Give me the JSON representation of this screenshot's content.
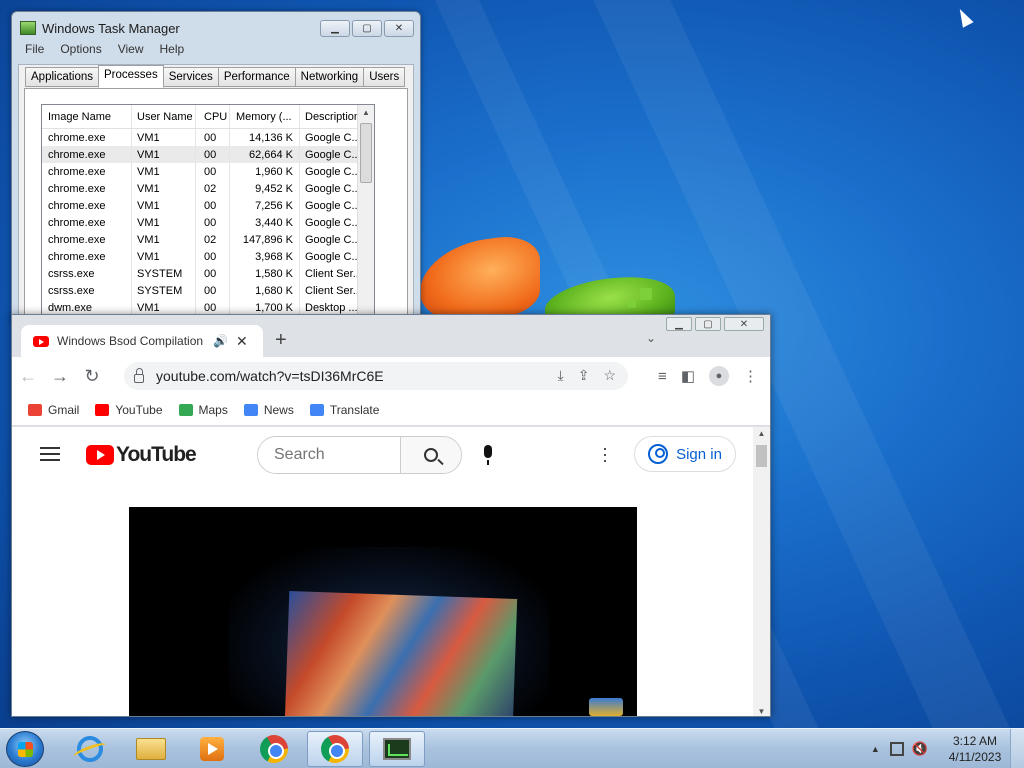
{
  "task_manager": {
    "title": "Windows Task Manager",
    "menu": [
      "File",
      "Options",
      "View",
      "Help"
    ],
    "tabs": [
      "Applications",
      "Processes",
      "Services",
      "Performance",
      "Networking",
      "Users"
    ],
    "active_tab": "Processes",
    "columns": [
      "Image Name",
      "User Name",
      "CPU",
      "Memory (...",
      "Description"
    ],
    "rows": [
      {
        "name": "chrome.exe",
        "user": "VM1",
        "cpu": "00",
        "mem": "14,136 K",
        "desc": "Google C..."
      },
      {
        "name": "chrome.exe",
        "user": "VM1",
        "cpu": "00",
        "mem": "62,664 K",
        "desc": "Google C..."
      },
      {
        "name": "chrome.exe",
        "user": "VM1",
        "cpu": "00",
        "mem": "1,960 K",
        "desc": "Google C..."
      },
      {
        "name": "chrome.exe",
        "user": "VM1",
        "cpu": "02",
        "mem": "9,452 K",
        "desc": "Google C..."
      },
      {
        "name": "chrome.exe",
        "user": "VM1",
        "cpu": "00",
        "mem": "7,256 K",
        "desc": "Google C..."
      },
      {
        "name": "chrome.exe",
        "user": "VM1",
        "cpu": "00",
        "mem": "3,440 K",
        "desc": "Google C..."
      },
      {
        "name": "chrome.exe",
        "user": "VM1",
        "cpu": "02",
        "mem": "147,896 K",
        "desc": "Google C..."
      },
      {
        "name": "chrome.exe",
        "user": "VM1",
        "cpu": "00",
        "mem": "3,968 K",
        "desc": "Google C..."
      },
      {
        "name": "csrss.exe",
        "user": "SYSTEM",
        "cpu": "00",
        "mem": "1,580 K",
        "desc": "Client Ser..."
      },
      {
        "name": "csrss.exe",
        "user": "SYSTEM",
        "cpu": "00",
        "mem": "1,680 K",
        "desc": "Client Ser..."
      },
      {
        "name": "dwm.exe",
        "user": "VM1",
        "cpu": "00",
        "mem": "1,700 K",
        "desc": "Desktop ..."
      }
    ]
  },
  "chrome": {
    "tab_title": "Windows Bsod Compilation",
    "url": "youtube.com/watch?v=tsDI36MrC6E",
    "bookmarks": [
      {
        "label": "Gmail",
        "color": "#ea4335"
      },
      {
        "label": "YouTube",
        "color": "#ff0000"
      },
      {
        "label": "Maps",
        "color": "#34a853"
      },
      {
        "label": "News",
        "color": "#4285f4"
      },
      {
        "label": "Translate",
        "color": "#4285f4"
      }
    ]
  },
  "youtube": {
    "logo_text": "YouTube",
    "search_placeholder": "Search",
    "sign_in_label": "Sign in"
  },
  "taskbar": {
    "time": "3:12 AM",
    "date": "4/11/2023"
  },
  "colors": {
    "accent_youtube": "#ff0000",
    "link_blue": "#065fd4"
  }
}
